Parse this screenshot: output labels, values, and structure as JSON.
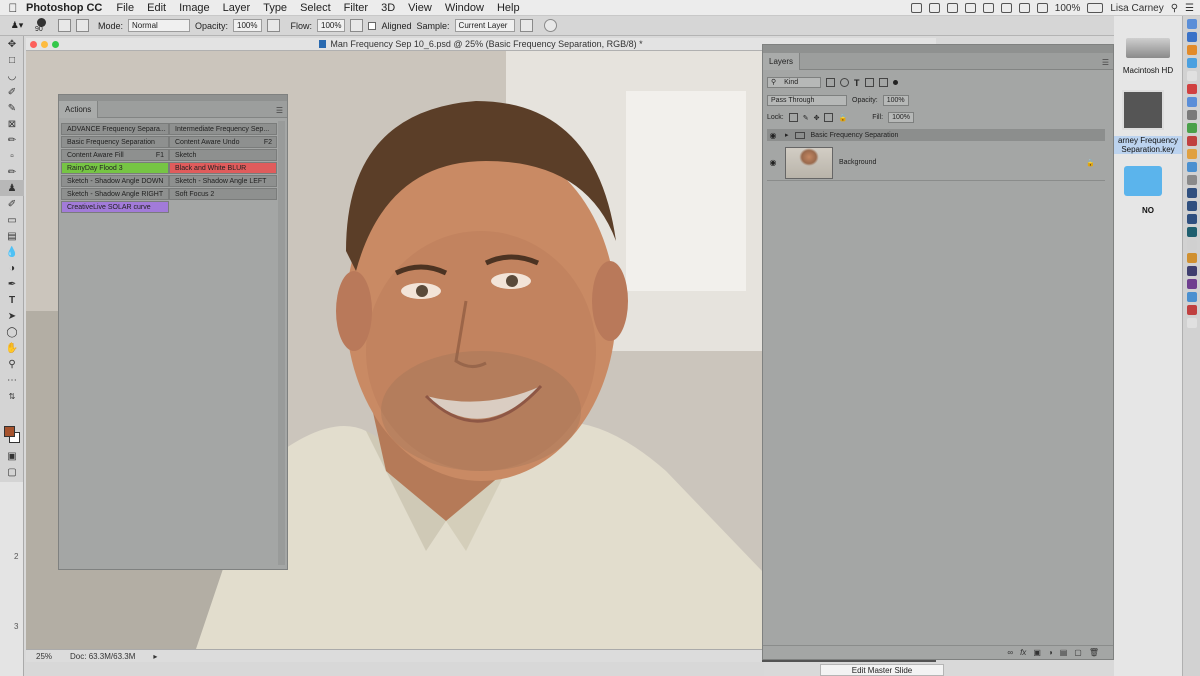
{
  "menubar": {
    "app": "Photoshop CC",
    "items": [
      "File",
      "Edit",
      "Image",
      "Layer",
      "Type",
      "Select",
      "Filter",
      "3D",
      "View",
      "Window",
      "Help"
    ],
    "battery": "100%",
    "user": "Lisa Carney"
  },
  "options": {
    "brush_size": "90",
    "mode_label": "Mode:",
    "mode_value": "Normal",
    "opacity_label": "Opacity:",
    "opacity_value": "100%",
    "flow_label": "Flow:",
    "flow_value": "100%",
    "aligned_label": "Aligned",
    "sample_label": "Sample:",
    "sample_value": "Current Layer"
  },
  "document": {
    "title": "Man Frequency Sep 10_6.psd @ 25% (Basic Frequency Separation, RGB/8) *",
    "zoom": "25%",
    "doc_size": "Doc: 63.3M/63.3M"
  },
  "actions_panel": {
    "tab": "Actions",
    "buttons": [
      {
        "label": "ADVANCE Frequency Separa...",
        "key": "",
        "color": ""
      },
      {
        "label": "Intermediate Frequency Sep...",
        "key": "",
        "color": ""
      },
      {
        "label": "Basic Frequency Separation",
        "key": "",
        "color": ""
      },
      {
        "label": "Content Aware Undo",
        "key": "F2",
        "color": ""
      },
      {
        "label": "Content Aware Fill",
        "key": "F1",
        "color": ""
      },
      {
        "label": "Sketch",
        "key": "",
        "color": ""
      },
      {
        "label": "RainyDay Flood 3",
        "key": "",
        "color": "green"
      },
      {
        "label": "Black and White BLUR",
        "key": "",
        "color": "red"
      },
      {
        "label": "Sketch - Shadow Angle DOWN",
        "key": "",
        "color": ""
      },
      {
        "label": "Sketch - Shadow Angle LEFT",
        "key": "",
        "color": ""
      },
      {
        "label": "Sketch - Shadow Angle RIGHT",
        "key": "",
        "color": ""
      },
      {
        "label": "Soft Focus 2",
        "key": "",
        "color": ""
      },
      {
        "label": "CreativeLive SOLAR curve",
        "key": "",
        "color": "violet"
      }
    ]
  },
  "layers_panel": {
    "tab": "Layers",
    "filter_value": "Kind",
    "blend_value": "Pass Through",
    "opacity_label": "Opacity:",
    "opacity_value": "100%",
    "lock_label": "Lock:",
    "fill_label": "Fill:",
    "fill_value": "100%",
    "layers": [
      {
        "name": "Basic Frequency Separation",
        "type": "group"
      },
      {
        "name": "Background",
        "type": "image"
      }
    ]
  },
  "desktop": {
    "drive": "Macintosh HD",
    "file": "arney Frequency\nSeparation.key",
    "folder": "NO"
  },
  "keynote": {
    "edit_master": "Edit Master Slide"
  },
  "ruler_numbers": [
    "2",
    "3"
  ]
}
